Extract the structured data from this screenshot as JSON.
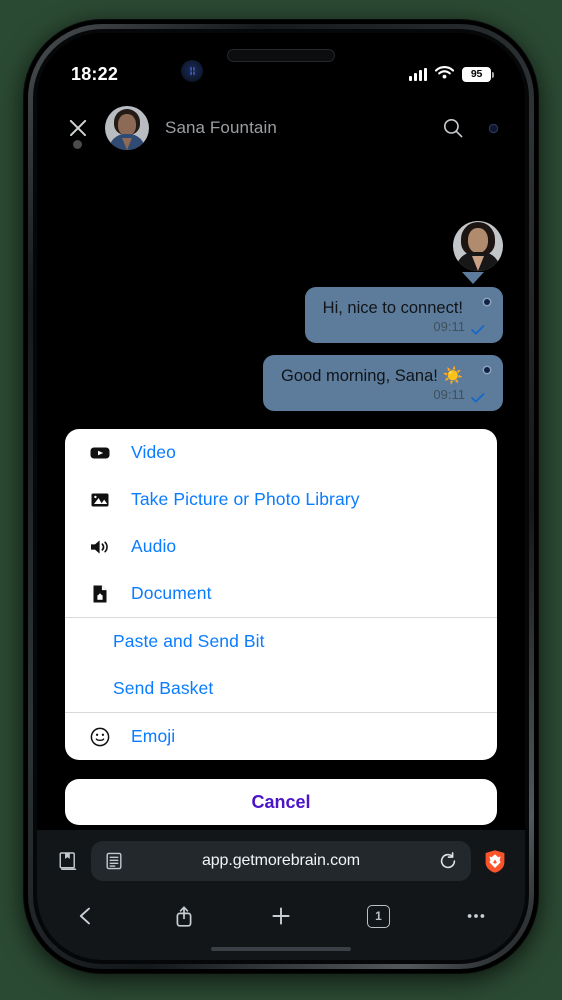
{
  "background_color": "#2b4a33",
  "status_bar": {
    "time": "18:22",
    "location_icon": "location-indicator-icon",
    "signal_icon": "cellular-signal-icon",
    "wifi_icon": "wifi-icon",
    "battery_level": "95",
    "battery_icon": "battery-icon"
  },
  "chat_header": {
    "close_icon": "close-icon",
    "avatar": "contact-avatar",
    "contact_name": "Sana Fountain",
    "search_icon": "search-icon",
    "more_icon": "more-options-icon"
  },
  "messages": [
    {
      "text": "Hi, nice to connect!",
      "time": "09:11",
      "status_icon": "read-check-icon",
      "outgoing": true
    },
    {
      "text": "Good morning, Sana! ☀️",
      "time": "09:11",
      "status_icon": "read-check-icon",
      "outgoing": true
    }
  ],
  "bubble_color": "#5d7b9a",
  "accent_color": "#0a7cff",
  "cancel_color": "#4b14c9",
  "action_sheet": {
    "groups": [
      {
        "items": [
          {
            "label": "Video",
            "icon": "video-icon"
          },
          {
            "label": "Take Picture or Photo Library",
            "icon": "photo-library-icon"
          },
          {
            "label": "Audio",
            "icon": "audio-icon"
          },
          {
            "label": "Document",
            "icon": "document-icon"
          }
        ]
      },
      {
        "items": [
          {
            "label": "Paste and Send Bit",
            "icon": ""
          },
          {
            "label": "Send Basket",
            "icon": ""
          }
        ]
      },
      {
        "items": [
          {
            "label": "Emoji",
            "icon": "emoji-icon"
          }
        ]
      }
    ],
    "cancel_label": "Cancel"
  },
  "browser": {
    "bookmarks_icon": "bookmarks-icon",
    "reader_icon": "reader-mode-icon",
    "url": "app.getmorebrain.com",
    "reload_icon": "reload-icon",
    "shield_icon": "brave-shield-icon",
    "back_icon": "back-icon",
    "share_icon": "share-icon",
    "new_tab_icon": "new-tab-icon",
    "tab_count": "1",
    "menu_icon": "more-menu-icon"
  }
}
